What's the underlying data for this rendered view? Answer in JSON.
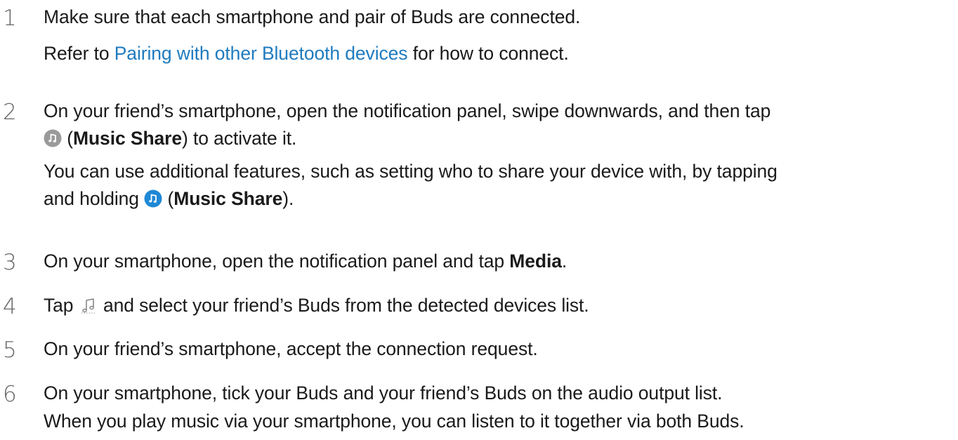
{
  "steps": [
    {
      "number": "1",
      "line1": "Make sure that each smartphone and pair of Buds are connected.",
      "sub_prefix": "Refer to ",
      "link_text": "Pairing with other Bluetooth devices",
      "sub_suffix": " for how to connect."
    },
    {
      "number": "2",
      "line1": "On your friend’s smartphone, open the notification panel, swipe downwards, and then tap",
      "line2_open": " (",
      "line2_bold": "Music Share",
      "line2_close": ") to activate it.",
      "sub_line1": "You can use additional features, such as setting who to share your device with, by tapping",
      "sub_line2_prefix": "and holding ",
      "sub_line2_open": " (",
      "sub_line2_bold": "Music Share",
      "sub_line2_close": ")."
    },
    {
      "number": "3",
      "prefix": "On your smartphone, open the notification panel and tap ",
      "bold": "Media",
      "suffix": "."
    },
    {
      "number": "4",
      "prefix": "Tap ",
      "suffix": " and select your friend’s Buds from the detected devices list."
    },
    {
      "number": "5",
      "text": "On your friend’s smartphone, accept the connection request."
    },
    {
      "number": "6",
      "line1": "On your smartphone, tick your Buds and your friend’s Buds on the audio output list.",
      "line2": "When you play music via your smartphone, you can listen to it together via both Buds."
    }
  ],
  "icons": {
    "music_share_off": "music-share-grey-icon",
    "music_share_on": "music-share-blue-icon",
    "audio_output": "audio-output-note-icon"
  },
  "colors": {
    "link": "#1f7bbf",
    "number": "#666666",
    "icon_grey": "#9a9a9a",
    "icon_blue": "#1f88d6"
  }
}
